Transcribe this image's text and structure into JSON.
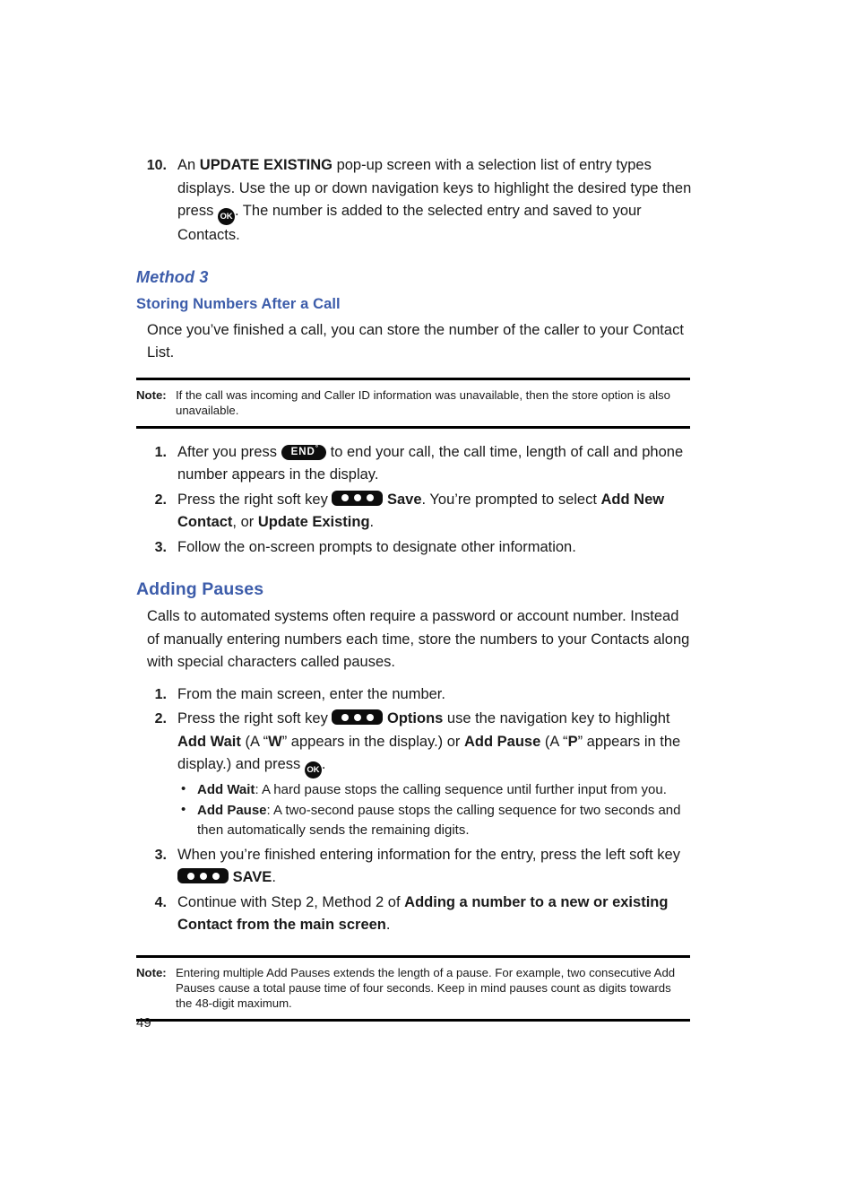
{
  "page": {
    "number": "49"
  },
  "step10": {
    "num": "10.",
    "t1": "An ",
    "b1": "UPDATE EXISTING",
    "t2": " pop-up screen with a selection list of entry types displays. Use the up or down navigation keys to highlight the desired type then press ",
    "ok_icon": "OK",
    "t3": ". The number is added to the selected entry and saved to your Contacts."
  },
  "method3": {
    "heading": "Method 3",
    "subheading": "Storing Numbers After a Call",
    "intro": "Once you’ve finished a call, you can store the number of the caller to your Contact List.",
    "note": {
      "label": "Note:",
      "text": "If the call was incoming and Caller ID information was unavailable, then the store option is also unavailable."
    },
    "steps": [
      {
        "num": "1.",
        "t1": "After you press ",
        "key": "END",
        "key_sup": "°",
        "t2": " to end your call, the call time, length of call and phone number appears in the display."
      },
      {
        "num": "2.",
        "t1": "Press the right soft key ",
        "softkey": "soft-key-three-dots",
        "b1": "Save",
        "t2": ". You’re prompted to select ",
        "b2": "Add New Contact",
        "t3": ", or ",
        "b3": "Update Existing",
        "t4": "."
      },
      {
        "num": "3.",
        "t1": "Follow the on-screen prompts to designate other information."
      }
    ]
  },
  "adding_pauses": {
    "heading": "Adding Pauses",
    "intro": "Calls to automated systems often require a password or account number. Instead of manually entering numbers each time, store the numbers to your Contacts along with special characters called pauses.",
    "steps": [
      {
        "num": "1.",
        "t1": "From the main screen, enter the number."
      },
      {
        "num": "2.",
        "t1": "Press the right soft key ",
        "softkey": "soft-key-three-dots",
        "b1": "Options",
        "t2": " use the navigation key to highlight ",
        "b2": "Add Wait",
        "t3": " (A “",
        "b3": "W",
        "t4": "” appears in the display.) or ",
        "b4": "Add Pause",
        "t5": " (A “",
        "b5": "P",
        "t6": "” appears in the display.) and press ",
        "ok_icon": "OK",
        "t7": "."
      },
      {
        "num": "3.",
        "t1": "When you’re finished entering information for the entry, press the left soft key ",
        "softkey": "soft-key-three-dots",
        "b1": "SAVE",
        "t2": "."
      },
      {
        "num": "4.",
        "t1": "Continue with Step 2, Method 2 of ",
        "b1": "Adding a number to a new or existing Contact from the main screen",
        "t2": "."
      }
    ],
    "bullets": [
      {
        "bullet": "•",
        "b1": "Add Wait",
        "t1": ": A hard pause stops the calling sequence until further input from you."
      },
      {
        "bullet": "•",
        "b1": "Add Pause",
        "t1": ": A two-second pause stops the calling sequence for two seconds and then automatically sends the remaining digits."
      }
    ],
    "note": {
      "label": "Note:",
      "text": "Entering multiple Add Pauses extends the length of a pause. For example, two consecutive Add Pauses cause a total pause time of four seconds. Keep in mind pauses count as digits towards the 48-digit maximum."
    }
  },
  "colors": {
    "heading_blue": "#3c5caa",
    "body_black": "#1a1a1a",
    "key_black": "#0d0d0d"
  }
}
